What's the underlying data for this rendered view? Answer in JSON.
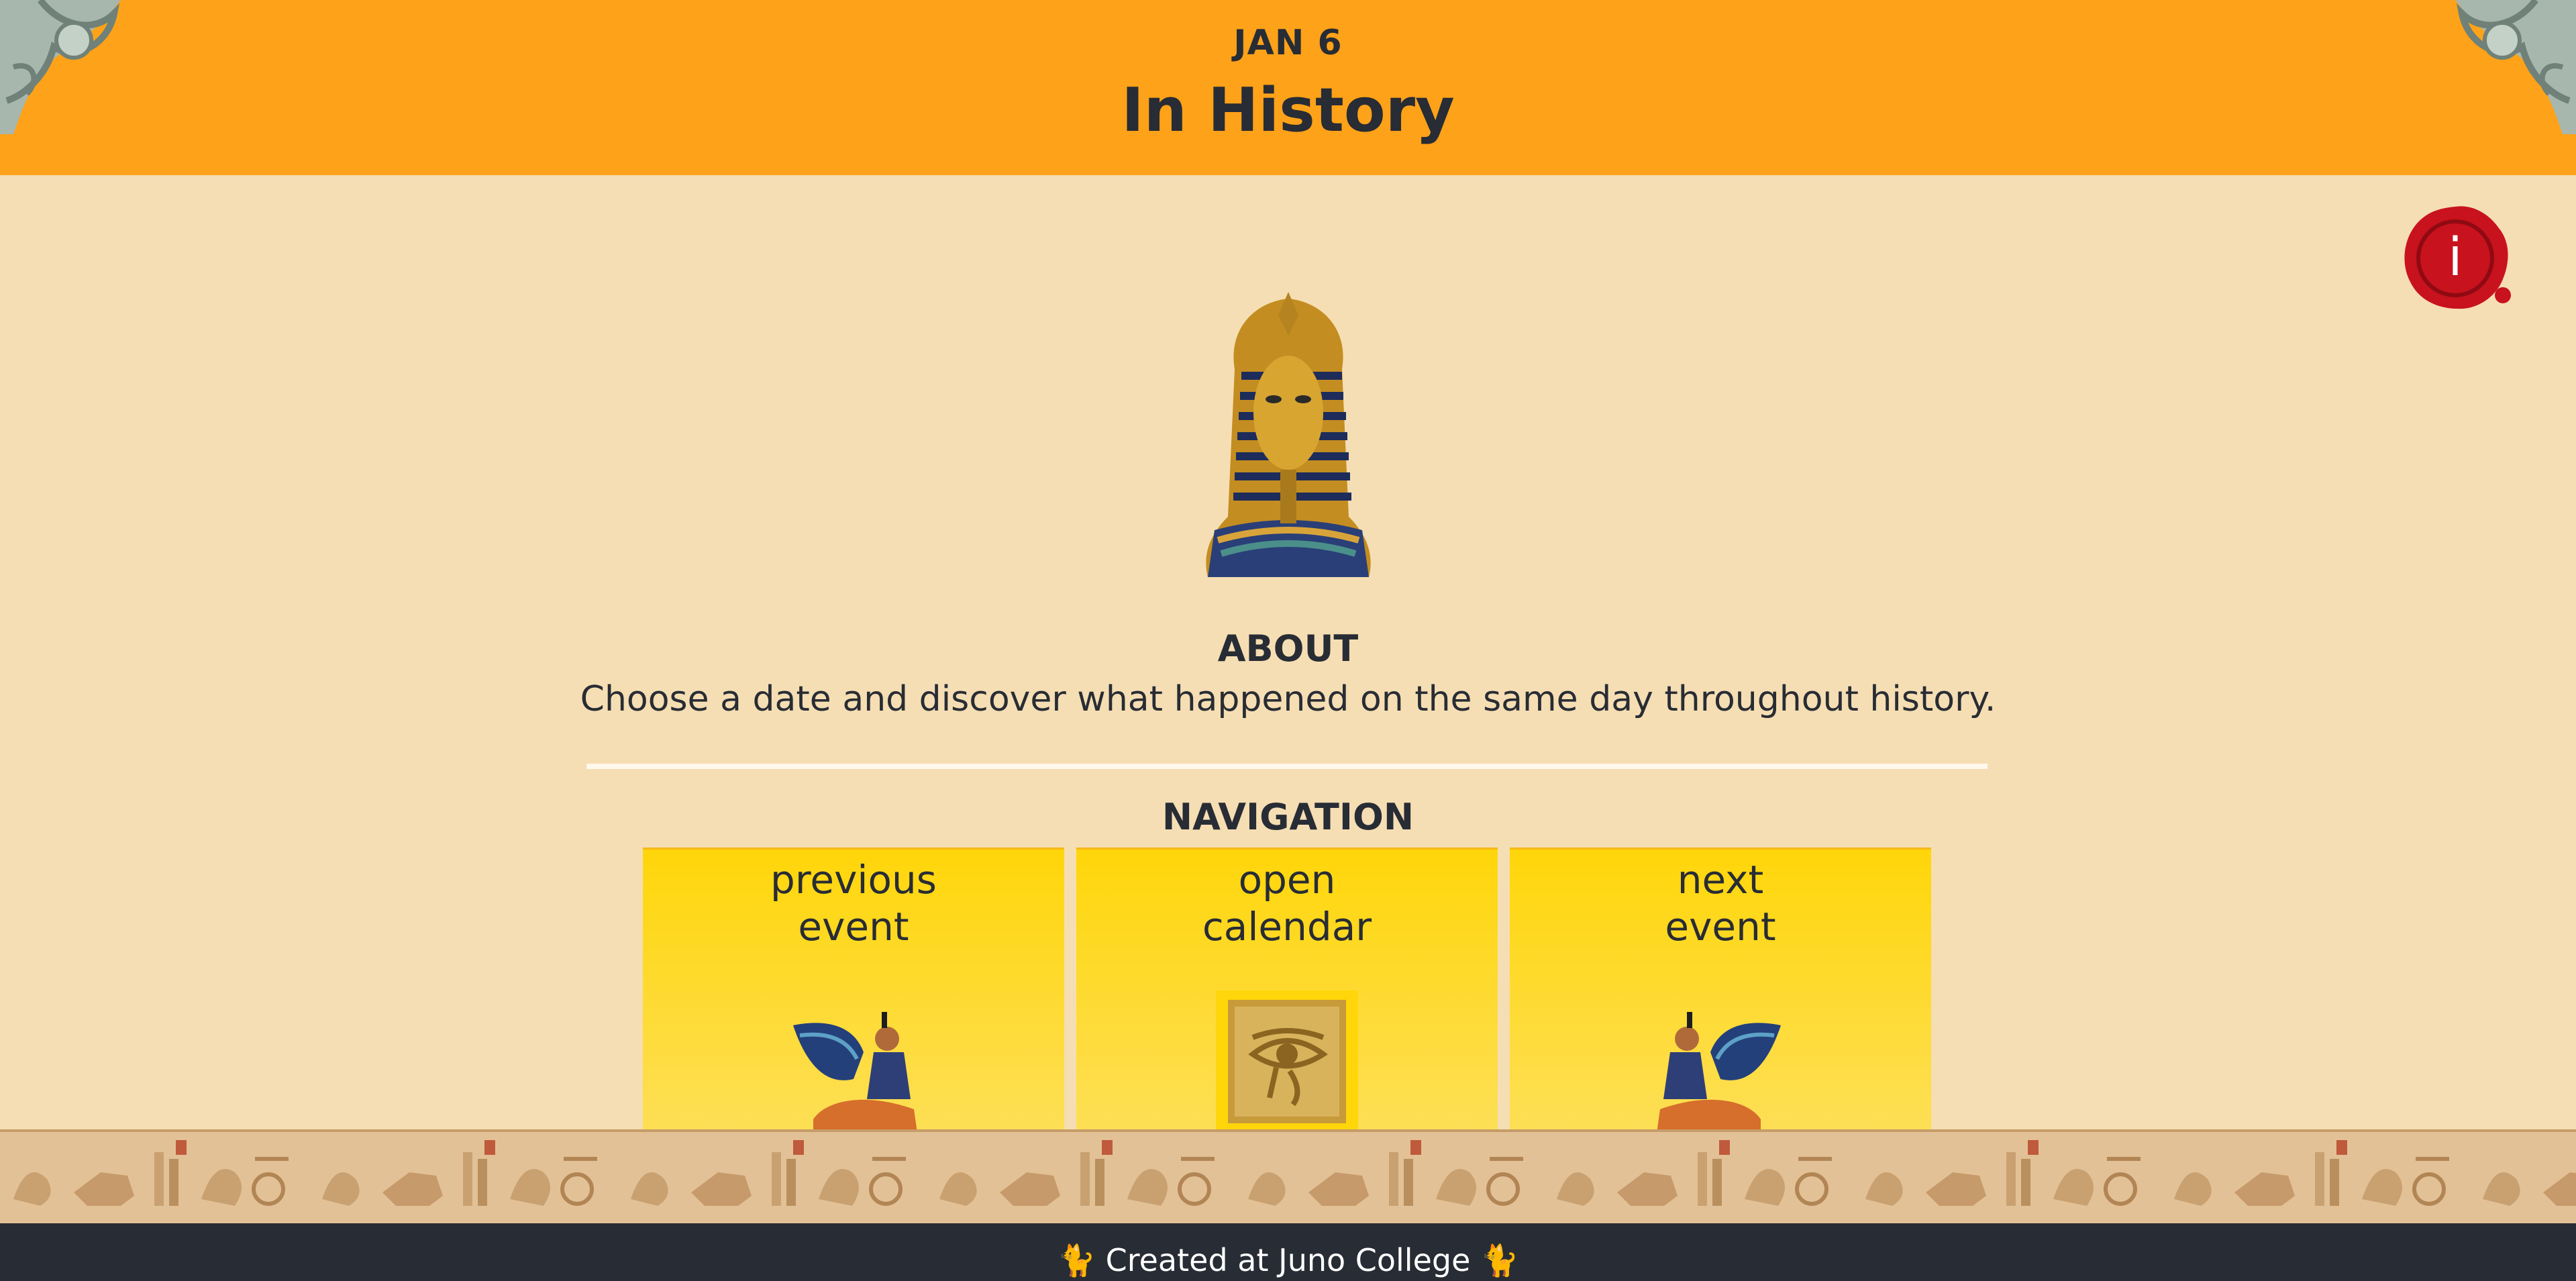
{
  "header": {
    "date": "JAN 6",
    "title": "In History"
  },
  "info_button": {
    "icon": "info-seal-icon",
    "glyph": "i",
    "color": "#c8121d"
  },
  "about": {
    "heading": "ABOUT",
    "text": "Choose a date and discover what happened on the same day throughout history."
  },
  "navigation": {
    "heading": "NAVIGATION",
    "cards": [
      {
        "line1": "previous",
        "line2": "event",
        "icon": "winged-goddess-icon"
      },
      {
        "line1": "open",
        "line2": "calendar",
        "icon": "eye-of-horus-icon"
      },
      {
        "line1": "next",
        "line2": "event",
        "icon": "winged-goddess-icon"
      }
    ]
  },
  "footer": {
    "text": "Created at Juno College",
    "icon": "cat-icon"
  },
  "colors": {
    "header_bg": "#fea219",
    "page_bg": "#f5deb3",
    "card_bg": "#ffd60a",
    "footer_bg": "#282c34"
  }
}
